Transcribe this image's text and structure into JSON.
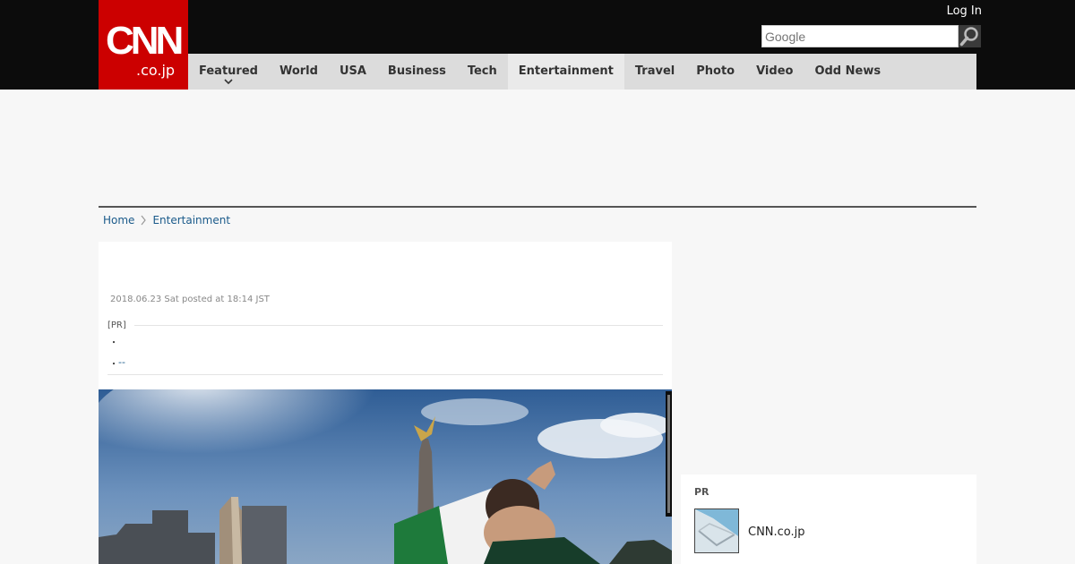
{
  "header": {
    "logo_main": "CNN",
    "logo_sub": ".co.jp",
    "login_label": "Log In",
    "search_placeholder": "Google"
  },
  "nav": {
    "items": [
      {
        "label": "Featured"
      },
      {
        "label": "World"
      },
      {
        "label": "USA"
      },
      {
        "label": "Business"
      },
      {
        "label": "Tech"
      },
      {
        "label": "Entertainment"
      },
      {
        "label": "Travel"
      },
      {
        "label": "Photo"
      },
      {
        "label": "Video"
      },
      {
        "label": "Odd News"
      }
    ],
    "active_index": 5
  },
  "breadcrumb": {
    "home": "Home",
    "section": "Entertainment"
  },
  "article": {
    "dateline": "2018.06.23 Sat posted at 18:14 JST",
    "pr_label": "[PR]",
    "bullet_1": "・",
    "bullet_2": "・",
    "pr_link": "--"
  },
  "sidebar_pr": {
    "title": "PR",
    "site": "CNN.co.jp"
  },
  "colors": {
    "brand_red": "#cc0000",
    "top_bar": "#0c0c0c",
    "nav_bg": "#dcdcdc",
    "link": "#1a5a8a"
  },
  "icons": {
    "search": "magnifier-icon",
    "nav_dropdown": "chevron-down-icon",
    "breadcrumb_sep": "chevron-right-icon"
  }
}
